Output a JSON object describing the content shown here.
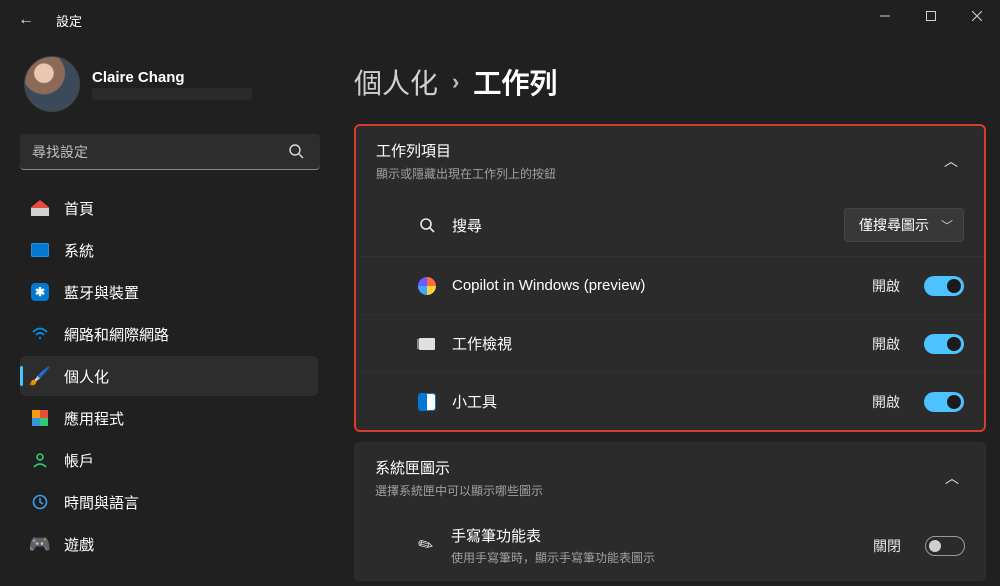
{
  "titlebar": {
    "title": "設定"
  },
  "profile": {
    "name": "Claire Chang",
    "email": ""
  },
  "search": {
    "placeholder": "尋找設定"
  },
  "nav": {
    "items": [
      {
        "label": "首頁",
        "active": false
      },
      {
        "label": "系統",
        "active": false
      },
      {
        "label": "藍牙與裝置",
        "active": false
      },
      {
        "label": "網路和網際網路",
        "active": false
      },
      {
        "label": "個人化",
        "active": true
      },
      {
        "label": "應用程式",
        "active": false
      },
      {
        "label": "帳戶",
        "active": false
      },
      {
        "label": "時間與語言",
        "active": false
      },
      {
        "label": "遊戲",
        "active": false
      }
    ]
  },
  "breadcrumb": {
    "parent": "個人化",
    "sep": "›",
    "current": "工作列"
  },
  "section1": {
    "title": "工作列項目",
    "subtitle": "顯示或隱藏出現在工作列上的按鈕",
    "rows": {
      "search": {
        "label": "搜尋",
        "dropdown": "僅搜尋圖示"
      },
      "copilot": {
        "label": "Copilot in Windows (preview)",
        "state": "開啟"
      },
      "taskview": {
        "label": "工作檢視",
        "state": "開啟"
      },
      "widgets": {
        "label": "小工具",
        "state": "開啟"
      }
    }
  },
  "section2": {
    "title": "系統匣圖示",
    "subtitle": "選擇系統匣中可以顯示哪些圖示",
    "rows": {
      "pen": {
        "label": "手寫筆功能表",
        "sub": "使用手寫筆時，顯示手寫筆功能表圖示",
        "state": "關閉"
      }
    }
  }
}
